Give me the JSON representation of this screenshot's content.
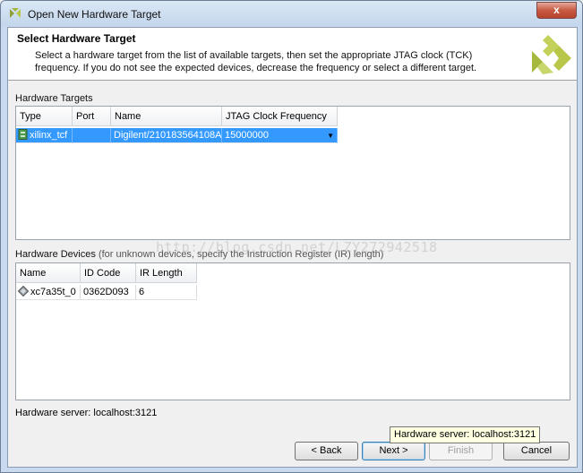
{
  "window": {
    "title": "Open New Hardware Target",
    "close_glyph": "x"
  },
  "header": {
    "title": "Select Hardware Target",
    "description": "Select a hardware target from the list of available targets, then set the appropriate JTAG clock (TCK) frequency. If you do not see the expected devices, decrease the frequency or select a different target."
  },
  "targets": {
    "label": "Hardware Targets",
    "columns": [
      "Type",
      "Port",
      "Name",
      "JTAG Clock Frequency"
    ],
    "rows": [
      {
        "type": "xilinx_tcf",
        "port": "",
        "name": "Digilent/210183564108A",
        "freq": "15000000",
        "selected": true
      }
    ]
  },
  "devices": {
    "label": "Hardware Devices",
    "label_note": "(for unknown devices, specify the Instruction Register (IR) length)",
    "columns": [
      "Name",
      "ID Code",
      "IR Length"
    ],
    "rows": [
      {
        "name": "xc7a35t_0",
        "id_code": "0362D093",
        "ir_length": "6"
      }
    ]
  },
  "status": "Hardware server: localhost:3121",
  "tooltip": "Hardware server: localhost:3121",
  "watermark": "http://blog.csdn.net/LZY272942518",
  "buttons": {
    "back": "< Back",
    "next": "Next >",
    "finish": "Finish",
    "cancel": "Cancel"
  },
  "icons": {
    "app": "xilinx-logo-icon",
    "target": "target-board-icon",
    "device": "fpga-chip-icon"
  },
  "colors": {
    "selection": "#3399ff",
    "logo": "#b8c64a"
  }
}
